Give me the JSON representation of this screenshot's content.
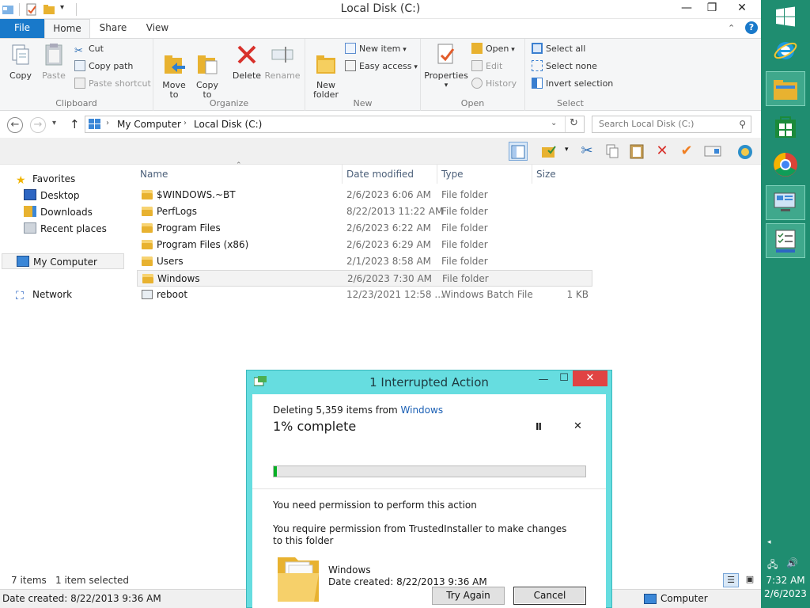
{
  "window": {
    "title": "Local Disk (C:)",
    "minimize_icon": "minimize-icon",
    "maximize_icon": "maximize-icon",
    "close_icon": "close-icon"
  },
  "ribbon_tabs": {
    "file": "File",
    "home": "Home",
    "share": "Share",
    "view": "View"
  },
  "ribbon": {
    "clipboard": {
      "label": "Clipboard",
      "copy": "Copy",
      "paste": "Paste",
      "cut": "Cut",
      "copy_path": "Copy path",
      "paste_shortcut": "Paste shortcut"
    },
    "organize": {
      "label": "Organize",
      "move_to": "Move\nto",
      "copy_to": "Copy\nto",
      "delete": "Delete",
      "rename": "Rename"
    },
    "new": {
      "label": "New",
      "new_folder": "New\nfolder",
      "new_item": "New item",
      "easy_access": "Easy access"
    },
    "open": {
      "label": "Open",
      "properties": "Properties",
      "open": "Open",
      "edit": "Edit",
      "history": "History"
    },
    "select": {
      "label": "Select",
      "select_all": "Select all",
      "select_none": "Select none",
      "invert_selection": "Invert selection"
    }
  },
  "address": {
    "crumb1": "My Computer",
    "crumb2": "Local Disk (C:)",
    "search_placeholder": "Search Local Disk (C:)"
  },
  "nav": {
    "favorites": "Favorites",
    "desktop": "Desktop",
    "downloads": "Downloads",
    "recent": "Recent places",
    "computer": "My Computer",
    "network": "Network"
  },
  "columns": {
    "name": "Name",
    "date": "Date modified",
    "type": "Type",
    "size": "Size"
  },
  "files": [
    {
      "name": "$WINDOWS.~BT",
      "date": "2/6/2023 6:06 AM",
      "type": "File folder",
      "size": ""
    },
    {
      "name": "PerfLogs",
      "date": "8/22/2013 11:22 AM",
      "type": "File folder",
      "size": ""
    },
    {
      "name": "Program Files",
      "date": "2/6/2023 6:22 AM",
      "type": "File folder",
      "size": ""
    },
    {
      "name": "Program Files (x86)",
      "date": "2/6/2023 6:29 AM",
      "type": "File folder",
      "size": ""
    },
    {
      "name": "Users",
      "date": "2/1/2023 8:58 AM",
      "type": "File folder",
      "size": ""
    },
    {
      "name": "Windows",
      "date": "2/6/2023 7:30 AM",
      "type": "File folder",
      "size": ""
    },
    {
      "name": "reboot",
      "date": "12/23/2021 12:58 ...",
      "type": "Windows Batch File",
      "size": "1 KB"
    }
  ],
  "status": {
    "items": "7 items",
    "selected": "1 item selected",
    "date_created": "Date created: 8/22/2013 9:36 AM",
    "location": "Computer"
  },
  "dialog": {
    "title": "1 Interrupted Action",
    "deleting_prefix": "Deleting 5,359 items from",
    "deleting_link": "Windows",
    "percent_text": "1% complete",
    "progress": 0.01,
    "permission_title": "You need permission to perform this action",
    "permission_detail": "You require permission from TrustedInstaller to make changes to this folder",
    "item_name": "Windows",
    "item_date": "Date created: 8/22/2013 9:36 AM",
    "try_again": "Try Again",
    "cancel": "Cancel",
    "pause_glyph": "II",
    "stop_glyph": "✕"
  },
  "taskbar": {
    "time": "7:32 AM",
    "date": "2/6/2023"
  },
  "colors": {
    "file_tab": "#1979ca",
    "dialog_frame": "#66dde0",
    "close_button": "#e04343",
    "charms_bg": "#1f8d70",
    "progress_fill": "#06b025"
  }
}
